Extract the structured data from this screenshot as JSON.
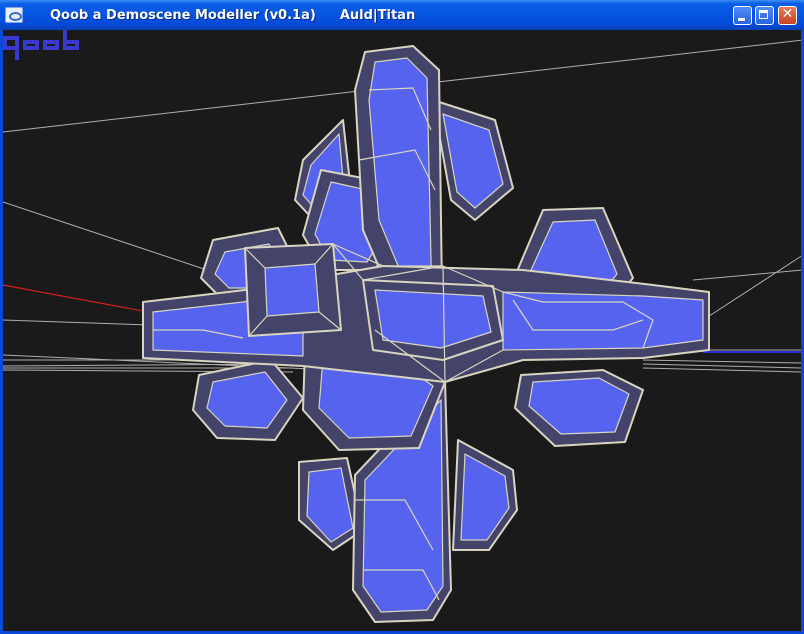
{
  "window": {
    "app_title": "Qoob a Demoscene Modeller (v0.1a)",
    "authors": "Auld|Titan",
    "close_glyph": "✕"
  },
  "viewport": {
    "background_color": "#1a1a1a",
    "face_color": "#5563ef",
    "frame_color": "#44446a",
    "edge_color": "#d8d4c0",
    "axis_x_color": "#d42020",
    "axis_z_color": "#2b2bd8"
  },
  "logo": {
    "label": "qoob",
    "icon": "qoob-logo-icon"
  }
}
